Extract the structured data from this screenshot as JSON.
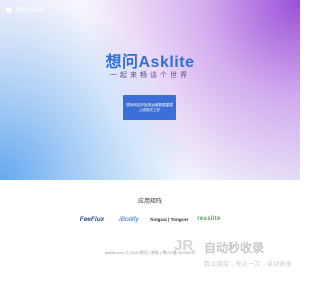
{
  "header": {
    "brand_text": "想问Asklite"
  },
  "hero": {
    "title": "想问Asklite",
    "tagline": "一起来畅谈个世界",
    "notice": {
      "line1": "想问网站开始的运营数据重建",
      "line2": "上线相关工作"
    }
  },
  "matrix": {
    "title": "应用矩阵",
    "apps": [
      {
        "name": "FeeFlux"
      },
      {
        "name": "iBodify"
      },
      {
        "name": "Tongcai | Tongcer"
      },
      {
        "name": "resslite"
      }
    ]
  },
  "footer": {
    "text": "asklite.com © 2025 想问 | 隐私 | 粤ICP备 000000号"
  },
  "watermark": {
    "logo": "JR",
    "title": "自动秒收录",
    "slogan": "数上链接→来访一次→自动收录"
  },
  "colors": {
    "accent_blue": "#2f6fd8",
    "notice_bg": "#3b6fd7",
    "gradient_purple": "#9546d6",
    "gradient_blue": "#5da4ee"
  }
}
